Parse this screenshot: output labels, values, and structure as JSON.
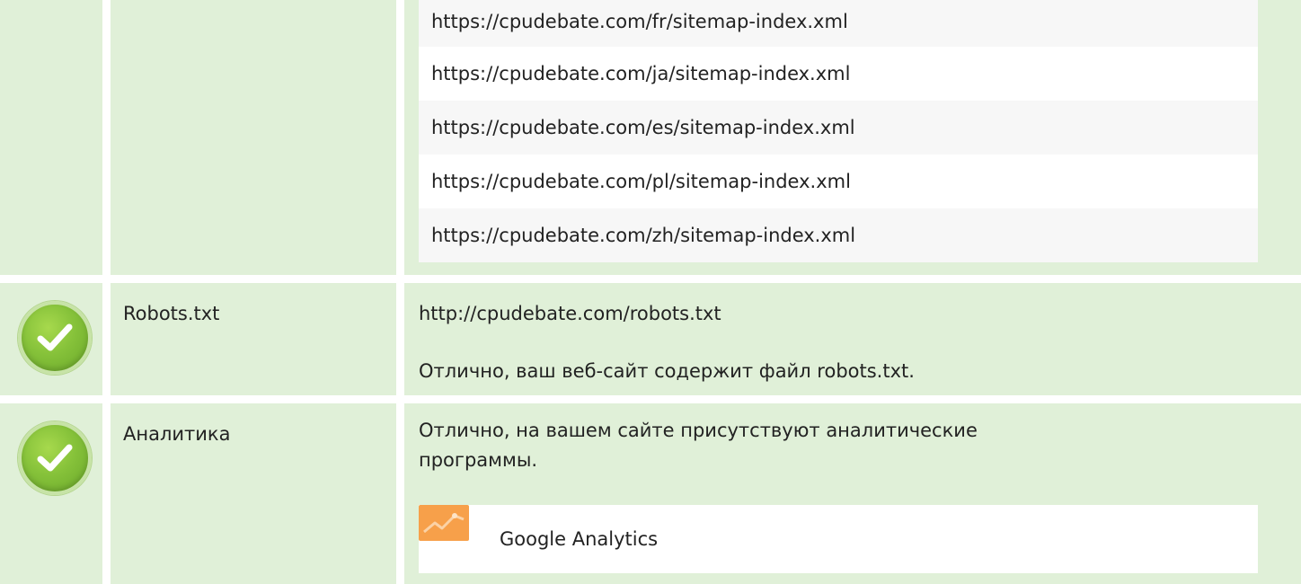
{
  "sitemaps": {
    "urls": [
      "https://cpudebate.com/fr/sitemap-index.xml",
      "https://cpudebate.com/ja/sitemap-index.xml",
      "https://cpudebate.com/es/sitemap-index.xml",
      "https://cpudebate.com/pl/sitemap-index.xml",
      "https://cpudebate.com/zh/sitemap-index.xml"
    ]
  },
  "robots": {
    "label": "Robots.txt",
    "status": "ok",
    "url": "http://cpudebate.com/robots.txt",
    "message": "Отлично, ваш веб-сайт содержит файл robots.txt."
  },
  "analytics": {
    "label": "Аналитика",
    "status": "ok",
    "message_line1": "Отлично, на вашем сайте присутствуют аналитические",
    "message_line2": "программы.",
    "tool_name": "Google Analytics",
    "tool_icon": "google-analytics-icon"
  },
  "colors": {
    "row_bg": "#e0f0d8",
    "check_green": "#86c23a",
    "analytics_orange": "#f7a04a"
  }
}
